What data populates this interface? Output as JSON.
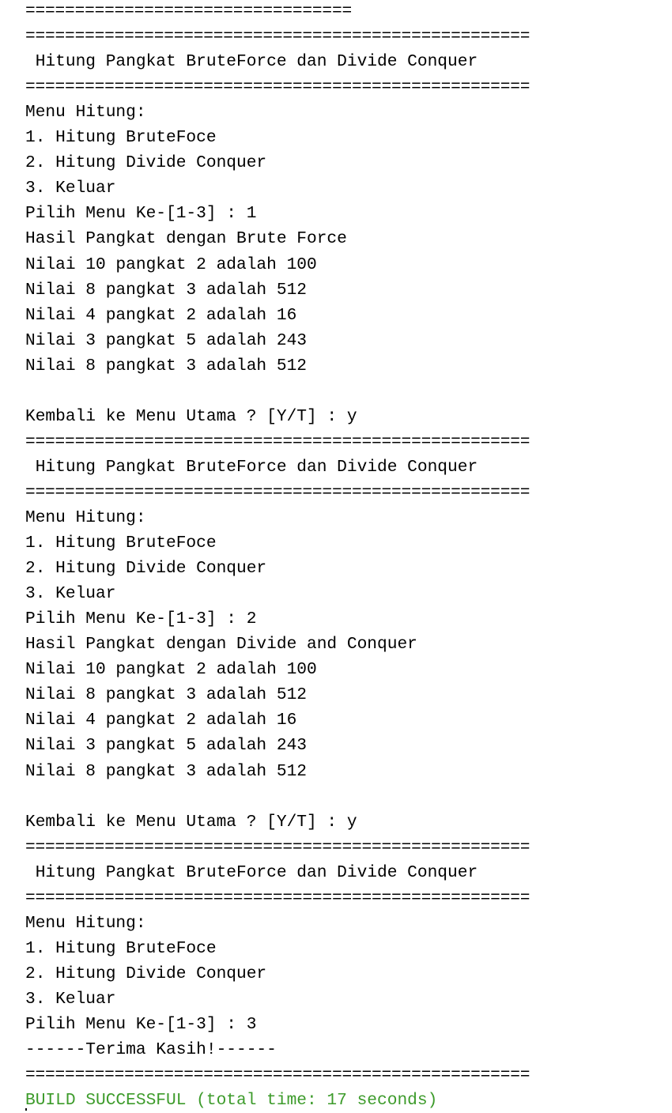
{
  "console": {
    "lines": [
      {
        "text": "=================================",
        "kind": "separator"
      },
      {
        "text": "===================================================",
        "kind": "separator"
      },
      {
        "text": " Hitung Pangkat BruteForce dan Divide Conquer",
        "kind": "heading"
      },
      {
        "text": "===================================================",
        "kind": "separator"
      },
      {
        "text": "Menu Hitung:",
        "kind": "output"
      },
      {
        "text": "1. Hitung BruteFoce",
        "kind": "output"
      },
      {
        "text": "2. Hitung Divide Conquer",
        "kind": "output"
      },
      {
        "text": "3. Keluar",
        "kind": "output"
      },
      {
        "text": "Pilih Menu Ke-[1-3] : 1",
        "kind": "prompt"
      },
      {
        "text": "Hasil Pangkat dengan Brute Force",
        "kind": "output"
      },
      {
        "text": "Nilai 10 pangkat 2 adalah 100",
        "kind": "output"
      },
      {
        "text": "Nilai 8 pangkat 3 adalah 512",
        "kind": "output"
      },
      {
        "text": "Nilai 4 pangkat 2 adalah 16",
        "kind": "output"
      },
      {
        "text": "Nilai 3 pangkat 5 adalah 243",
        "kind": "output"
      },
      {
        "text": "Nilai 8 pangkat 3 adalah 512",
        "kind": "output"
      },
      {
        "text": "",
        "kind": "blank"
      },
      {
        "text": "Kembali ke Menu Utama ? [Y/T] : y",
        "kind": "prompt"
      },
      {
        "text": "===================================================",
        "kind": "separator"
      },
      {
        "text": " Hitung Pangkat BruteForce dan Divide Conquer",
        "kind": "heading"
      },
      {
        "text": "===================================================",
        "kind": "separator"
      },
      {
        "text": "Menu Hitung:",
        "kind": "output"
      },
      {
        "text": "1. Hitung BruteFoce",
        "kind": "output"
      },
      {
        "text": "2. Hitung Divide Conquer",
        "kind": "output"
      },
      {
        "text": "3. Keluar",
        "kind": "output"
      },
      {
        "text": "Pilih Menu Ke-[1-3] : 2",
        "kind": "prompt"
      },
      {
        "text": "Hasil Pangkat dengan Divide and Conquer",
        "kind": "output"
      },
      {
        "text": "Nilai 10 pangkat 2 adalah 100",
        "kind": "output"
      },
      {
        "text": "Nilai 8 pangkat 3 adalah 512",
        "kind": "output"
      },
      {
        "text": "Nilai 4 pangkat 2 adalah 16",
        "kind": "output"
      },
      {
        "text": "Nilai 3 pangkat 5 adalah 243",
        "kind": "output"
      },
      {
        "text": "Nilai 8 pangkat 3 adalah 512",
        "kind": "output"
      },
      {
        "text": "",
        "kind": "blank"
      },
      {
        "text": "Kembali ke Menu Utama ? [Y/T] : y",
        "kind": "prompt"
      },
      {
        "text": "===================================================",
        "kind": "separator"
      },
      {
        "text": " Hitung Pangkat BruteForce dan Divide Conquer",
        "kind": "heading"
      },
      {
        "text": "===================================================",
        "kind": "separator"
      },
      {
        "text": "Menu Hitung:",
        "kind": "output"
      },
      {
        "text": "1. Hitung BruteFoce",
        "kind": "output"
      },
      {
        "text": "2. Hitung Divide Conquer",
        "kind": "output"
      },
      {
        "text": "3. Keluar",
        "kind": "output"
      },
      {
        "text": "Pilih Menu Ke-[1-3] : 3",
        "kind": "prompt"
      },
      {
        "text": "------Terima Kasih!------",
        "kind": "output"
      },
      {
        "text": "===================================================",
        "kind": "separator"
      },
      {
        "text": "BUILD SUCCESSFUL (total time: 17 seconds)",
        "kind": "success"
      }
    ]
  },
  "colors": {
    "background": "#ffffff",
    "text": "#000000",
    "success": "#3d9b2b"
  }
}
